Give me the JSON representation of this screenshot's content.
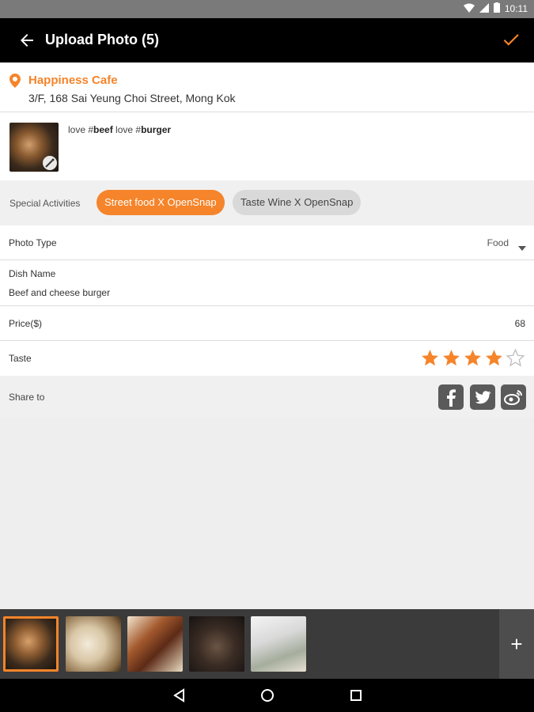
{
  "status": {
    "time": "10:11"
  },
  "appbar": {
    "title": "Upload Photo (5)"
  },
  "location": {
    "name": "Happiness Cafe",
    "address": "3/F, 168 Sai Yeung Choi Street, Mong Kok"
  },
  "caption": {
    "parts": [
      "love #",
      "beef",
      " love #",
      "burger"
    ]
  },
  "activities": {
    "label": "Special Activities",
    "chips": [
      "Street food X OpenSnap",
      "Taste Wine X OpenSnap"
    ]
  },
  "photo_type": {
    "label": "Photo Type",
    "value": "Food"
  },
  "dish": {
    "label": "Dish Name",
    "value": "Beef and cheese burger"
  },
  "price": {
    "label": "Price($)",
    "value": "68"
  },
  "taste": {
    "label": "Taste",
    "rating": 4,
    "max": 5
  },
  "share": {
    "label": "Share to",
    "icons": [
      "facebook-icon",
      "twitter-icon",
      "weibo-icon"
    ]
  },
  "strip": {
    "add_label": "+"
  },
  "colors": {
    "accent": "#f5842a",
    "appbar": "#000000",
    "status": "#7a7a7a"
  }
}
